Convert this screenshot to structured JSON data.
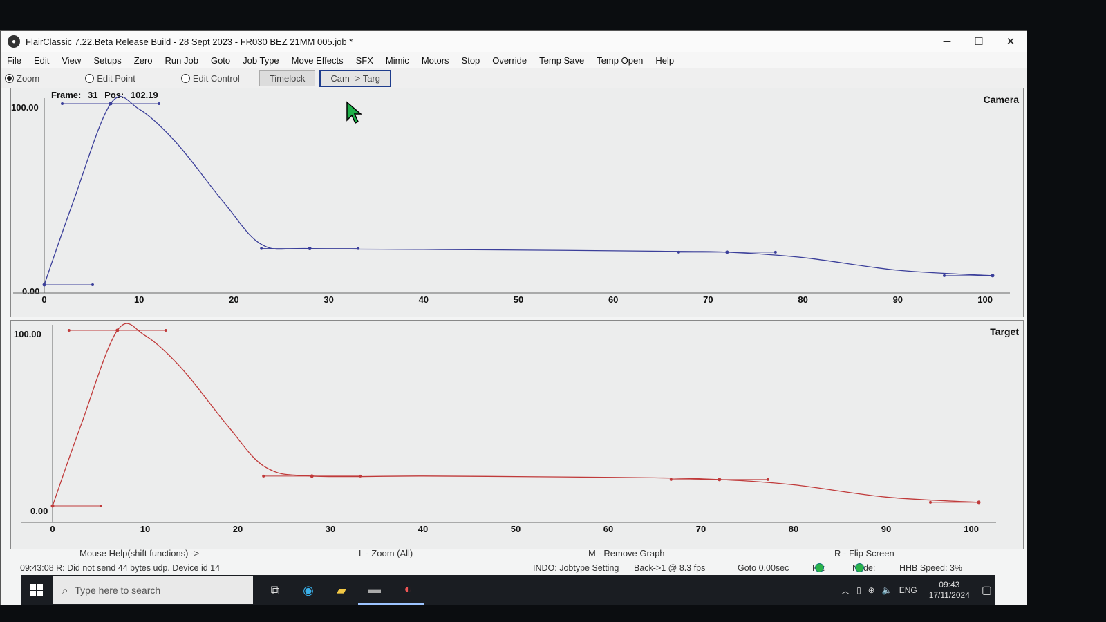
{
  "window": {
    "title": "FlairClassic 7.22.Beta Release Build - 28 Sept 2023 - FR030 BEZ 21MM 005.job *",
    "controls": [
      "─",
      "☐",
      "✕"
    ]
  },
  "menu": [
    "File",
    "Edit",
    "View",
    "Setups",
    "Zero",
    "Run Job",
    "Goto",
    "Job Type",
    "Move Effects",
    "SFX",
    "Mimic",
    "Motors",
    "Stop",
    "Override",
    "Temp Save",
    "Temp Open",
    "Help"
  ],
  "toolbar": {
    "radios": [
      {
        "label": "Zoom",
        "selected": true
      },
      {
        "label": "Edit Point",
        "selected": false
      },
      {
        "label": "Edit Control",
        "selected": false
      }
    ],
    "timelock": "Timelock",
    "cam_targ": "Cam -> Targ"
  },
  "frame_info": {
    "frame_label": "Frame:",
    "frame_value": "31",
    "pos_label": "Pos:",
    "pos_value": "102.19"
  },
  "graphs": {
    "camera": {
      "title": "Camera",
      "ymax": "100.00",
      "ymin": "0.00",
      "color": "#3b3f9a"
    },
    "target": {
      "title": "Target",
      "ymax": "100.00",
      "ymin": "0.00",
      "color": "#c03a3a"
    }
  },
  "chart_data": {
    "type": "line",
    "x_ticks": [
      "0",
      "10",
      "20",
      "30",
      "40",
      "50",
      "60",
      "70",
      "80",
      "90",
      "100"
    ],
    "xlim": [
      0,
      100
    ],
    "ylim": [
      0,
      100
    ],
    "series": [
      {
        "name": "Camera",
        "x": [
          0,
          3,
          7,
          10,
          14,
          19,
          23,
          28,
          40,
          55,
          65,
          72,
          80,
          90,
          100
        ],
        "y": [
          0,
          45,
          100,
          97,
          78,
          45,
          22,
          20,
          19.5,
          19,
          18.5,
          18,
          15,
          8,
          5
        ]
      },
      {
        "name": "Target",
        "x": [
          0,
          3,
          7,
          10,
          14,
          19,
          23,
          28,
          40,
          55,
          65,
          72,
          80,
          90,
          100
        ],
        "y": [
          0,
          45,
          100,
          97,
          78,
          45,
          22,
          17,
          17,
          16.5,
          16,
          15,
          12,
          5,
          2
        ]
      }
    ]
  },
  "help": {
    "mouse": "Mouse Help(shift functions) ->",
    "zoom": "L - Zoom (All)",
    "remove": "M - Remove Graph",
    "flip": "R - Flip Screen"
  },
  "status": {
    "message": "09:43:08  R: Did not send 44 bytes udp. Device id 14",
    "jobtype": "INDO: Jobtype Setting",
    "back": "Back->1 @ 8.3 fps",
    "goto": "Goto 0.00sec",
    "rt": "RT:",
    "node": "Node:",
    "speed": "HHB Speed:  3%"
  },
  "taskbar": {
    "search_placeholder": "Type here to search",
    "lang": "ENG",
    "time": "09:43",
    "date": "17/11/2024"
  }
}
